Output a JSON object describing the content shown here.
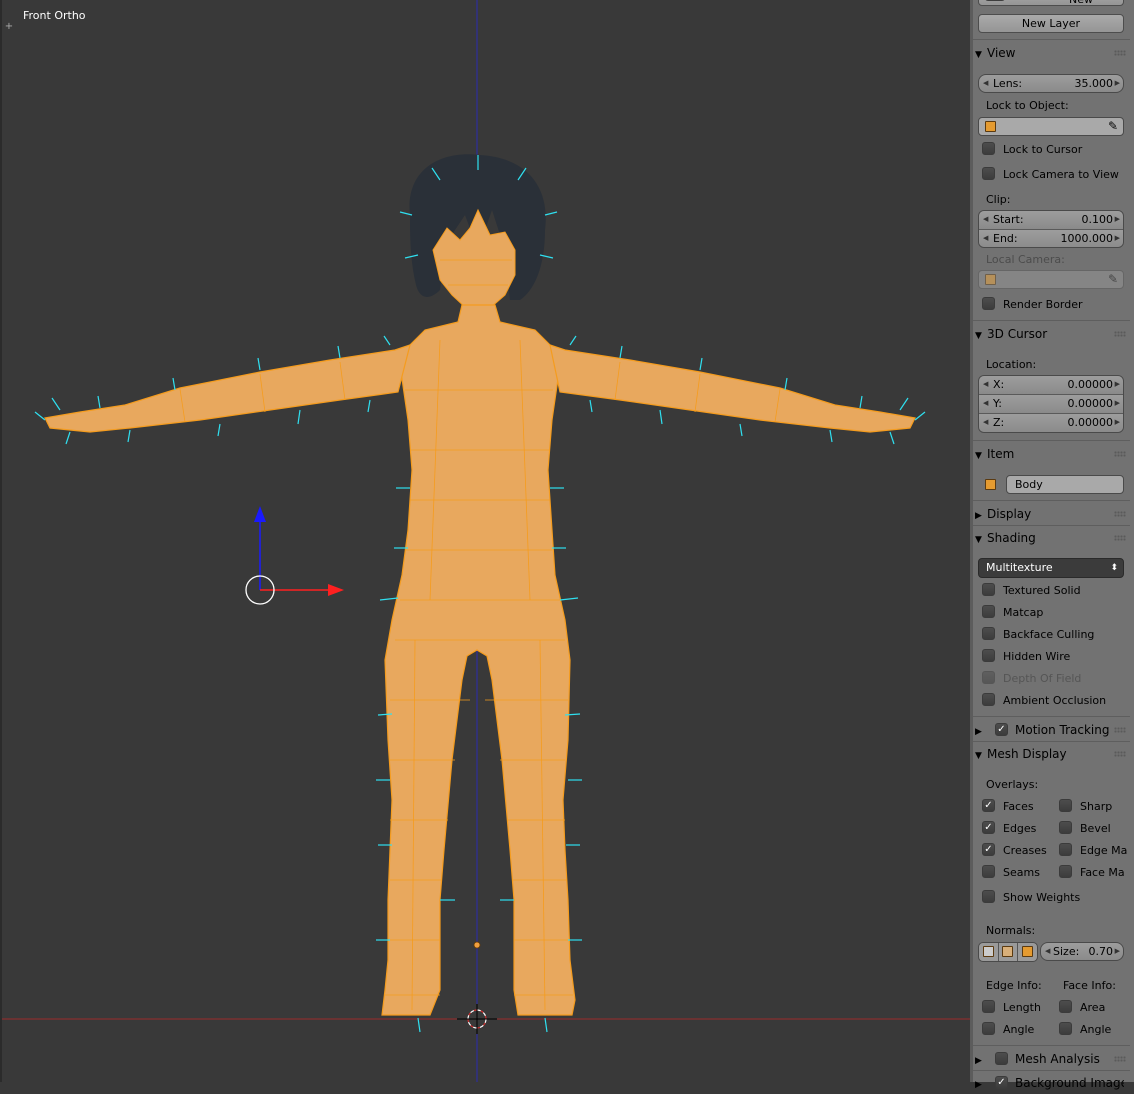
{
  "viewport": {
    "title": "Front Ortho",
    "corner_icon": "plus-icon"
  },
  "top": {
    "new_label": "New",
    "new_layer_label": "New Layer"
  },
  "view": {
    "title": "View",
    "lens_label": "Lens:",
    "lens_value": "35.000",
    "lock_to_object_label": "Lock to Object:",
    "lock_to_cursor": "Lock to Cursor",
    "lock_camera_to_view": "Lock Camera to View",
    "clip_label": "Clip:",
    "start_label": "Start:",
    "start_value": "0.100",
    "end_label": "End:",
    "end_value": "1000.000",
    "local_camera_label": "Local Camera:",
    "render_border": "Render Border"
  },
  "cursor3d": {
    "title": "3D Cursor",
    "location_label": "Location:",
    "x_label": "X:",
    "x_value": "0.00000",
    "y_label": "Y:",
    "y_value": "0.00000",
    "z_label": "Z:",
    "z_value": "0.00000"
  },
  "item": {
    "title": "Item",
    "name": "Body"
  },
  "display": {
    "title": "Display"
  },
  "shading": {
    "title": "Shading",
    "mode": "Multitexture",
    "options": [
      {
        "label": "Textured Solid",
        "checked": false,
        "enabled": true
      },
      {
        "label": "Matcap",
        "checked": false,
        "enabled": true
      },
      {
        "label": "Backface Culling",
        "checked": false,
        "enabled": true
      },
      {
        "label": "Hidden Wire",
        "checked": false,
        "enabled": true
      },
      {
        "label": "Depth Of Field",
        "checked": false,
        "enabled": false
      },
      {
        "label": "Ambient Occlusion",
        "checked": false,
        "enabled": true
      }
    ]
  },
  "motion_tracking": {
    "title": "Motion Tracking",
    "checked": true
  },
  "mesh_display": {
    "title": "Mesh Display",
    "overlays_label": "Overlays:",
    "left": [
      {
        "label": "Faces",
        "checked": true
      },
      {
        "label": "Edges",
        "checked": true
      },
      {
        "label": "Creases",
        "checked": true
      },
      {
        "label": "Seams",
        "checked": false
      }
    ],
    "right": [
      {
        "label": "Sharp",
        "checked": false
      },
      {
        "label": "Bevel",
        "checked": false
      },
      {
        "label": "Edge Ma",
        "checked": false
      },
      {
        "label": "Face Ma",
        "checked": false
      }
    ],
    "show_weights": "Show Weights",
    "normals_label": "Normals:",
    "size_label": "Size:",
    "size_value": "0.70",
    "edge_info_label": "Edge Info:",
    "face_info_label": "Face Info:",
    "length": "Length",
    "angle_edge": "Angle",
    "area": "Area",
    "angle_face": "Angle"
  },
  "mesh_analysis": {
    "title": "Mesh Analysis"
  },
  "background_images": {
    "title": "Background Images",
    "checked": true
  },
  "colors": {
    "body": "#e8a85e",
    "wire": "#f59c1e",
    "normals": "#2fe0f0",
    "hair": "#2a3038",
    "grid": "#393939"
  }
}
